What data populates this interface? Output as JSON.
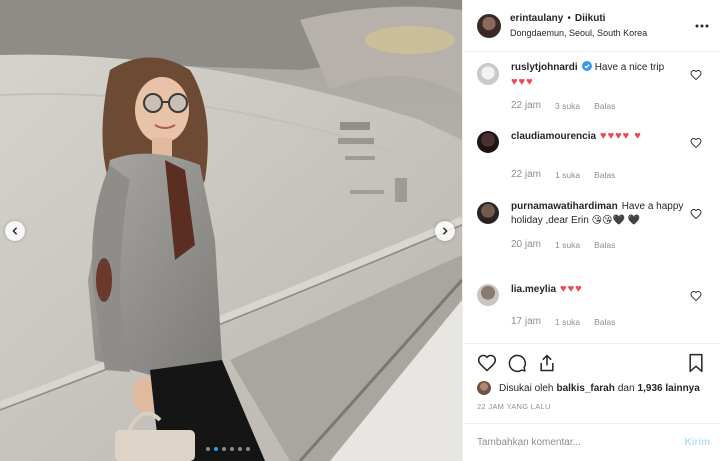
{
  "header": {
    "username": "erintaulany",
    "separator": "•",
    "follow_status": "Diikuti",
    "location": "Dongdaemun, Seoul, South Korea"
  },
  "comments": [
    {
      "user": "ruslytjohnardi",
      "verified": true,
      "text": "Have a nice trip",
      "emoji": "♥♥♥",
      "time": "22 jam",
      "likes": "3 suka",
      "reply": "Balas"
    },
    {
      "user": "claudiamourencia",
      "verified": false,
      "text": "",
      "emoji": "♥♥♥♥ ♥",
      "time": "22 jam",
      "likes": "1 suka",
      "reply": "Balas"
    },
    {
      "user": "purnamawatihardiman",
      "verified": false,
      "text": "Have a happy holiday ,dear Erin 😘😘🖤 🖤",
      "emoji": "",
      "time": "20 jam",
      "likes": "1 suka",
      "reply": "Balas"
    },
    {
      "user": "lia.meylia",
      "verified": false,
      "text": "",
      "emoji": "♥♥♥",
      "time": "17 jam",
      "likes": "1 suka",
      "reply": "Balas"
    }
  ],
  "likes": {
    "prefix": "Disukai oleh",
    "user": "balkis_farah",
    "middle": "dan",
    "count": "1,936 lainnya"
  },
  "post_time": "22 JAM YANG LALU",
  "add_comment": {
    "placeholder": "Tambahkan komentar...",
    "post_label": "Kirim"
  },
  "carousel": {
    "total": 6,
    "active_index": 1
  },
  "colors": {
    "accent": "#1da1f2",
    "heart": "#ed4956",
    "muted": "#8e8e8e",
    "post_disabled": "#b2dffc"
  },
  "icons": [
    "more-options-icon",
    "like-icon",
    "comment-icon",
    "share-icon",
    "save-icon",
    "verified-icon",
    "arrow-left-icon",
    "arrow-right-icon"
  ]
}
